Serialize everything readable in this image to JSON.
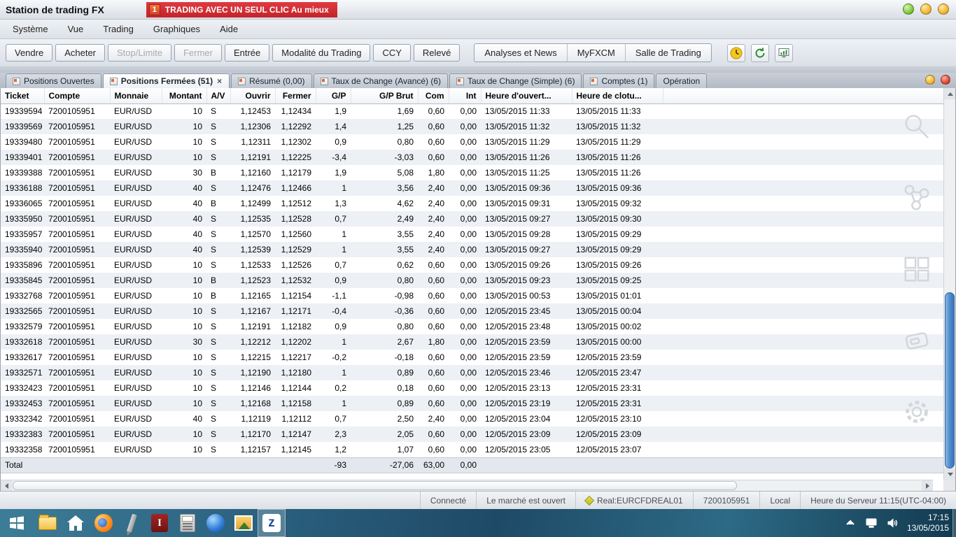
{
  "window": {
    "title": "Station de trading FX",
    "banner": {
      "badge": "1",
      "text": "TRADING AVEC UN SEUL CLIC Au mieux"
    },
    "controls": [
      "minimize",
      "restore",
      "close"
    ]
  },
  "menu": {
    "items": [
      "Système",
      "Vue",
      "Trading",
      "Graphiques",
      "Aide"
    ]
  },
  "toolbar": {
    "buttons": [
      {
        "label": "Vendre",
        "enabled": true
      },
      {
        "label": "Acheter",
        "enabled": true
      },
      {
        "label": "Stop/Limite",
        "enabled": false
      },
      {
        "label": "Fermer",
        "enabled": false
      },
      {
        "label": "Entrée",
        "enabled": true
      },
      {
        "label": "Modalité du Trading",
        "enabled": true
      },
      {
        "label": "CCY",
        "enabled": true
      },
      {
        "label": "Relevé",
        "enabled": true
      }
    ],
    "links": [
      "Analyses et News",
      "MyFXCM",
      "Salle de Trading"
    ],
    "icon_buttons": [
      "clock-icon",
      "refresh-icon",
      "market-monitor-icon"
    ]
  },
  "tabs": [
    {
      "label": "Positions Ouvertes",
      "active": false
    },
    {
      "label": "Positions Fermées (51)",
      "active": true,
      "close": "×"
    },
    {
      "label": "Résumé (0,00)",
      "active": false
    },
    {
      "label": "Taux de Change (Avancé) (6)",
      "active": false
    },
    {
      "label": "Taux de Change (Simple) (6)",
      "active": false
    },
    {
      "label": "Comptes (1)",
      "active": false
    },
    {
      "label": "Opération",
      "active": false
    }
  ],
  "table": {
    "columns": [
      "Ticket",
      "Compte",
      "Monnaie",
      "Montant",
      "A/V",
      "Ouvrir",
      "Fermer",
      "G/P",
      "G/P Brut",
      "Com",
      "Int",
      "Heure d'ouvert...",
      "Heure de clotu..."
    ],
    "column_keys": [
      "ticket",
      "compte",
      "monnaie",
      "montant",
      "av",
      "ouvrir",
      "fermer",
      "gp",
      "gp_brut",
      "com",
      "int",
      "heure_ouverture",
      "heure_cloture"
    ],
    "rows": [
      [
        "19339594",
        "7200105951",
        "EUR/USD",
        "10",
        "S",
        "1,12453",
        "1,12434",
        "1,9",
        "1,69",
        "0,60",
        "0,00",
        "13/05/2015 11:33",
        "13/05/2015 11:33"
      ],
      [
        "19339569",
        "7200105951",
        "EUR/USD",
        "10",
        "S",
        "1,12306",
        "1,12292",
        "1,4",
        "1,25",
        "0,60",
        "0,00",
        "13/05/2015 11:32",
        "13/05/2015 11:32"
      ],
      [
        "19339480",
        "7200105951",
        "EUR/USD",
        "10",
        "S",
        "1,12311",
        "1,12302",
        "0,9",
        "0,80",
        "0,60",
        "0,00",
        "13/05/2015 11:29",
        "13/05/2015 11:29"
      ],
      [
        "19339401",
        "7200105951",
        "EUR/USD",
        "10",
        "S",
        "1,12191",
        "1,12225",
        "-3,4",
        "-3,03",
        "0,60",
        "0,00",
        "13/05/2015 11:26",
        "13/05/2015 11:26"
      ],
      [
        "19339388",
        "7200105951",
        "EUR/USD",
        "30",
        "B",
        "1,12160",
        "1,12179",
        "1,9",
        "5,08",
        "1,80",
        "0,00",
        "13/05/2015 11:25",
        "13/05/2015 11:26"
      ],
      [
        "19336188",
        "7200105951",
        "EUR/USD",
        "40",
        "S",
        "1,12476",
        "1,12466",
        "1",
        "3,56",
        "2,40",
        "0,00",
        "13/05/2015 09:36",
        "13/05/2015 09:36"
      ],
      [
        "19336065",
        "7200105951",
        "EUR/USD",
        "40",
        "B",
        "1,12499",
        "1,12512",
        "1,3",
        "4,62",
        "2,40",
        "0,00",
        "13/05/2015 09:31",
        "13/05/2015 09:32"
      ],
      [
        "19335950",
        "7200105951",
        "EUR/USD",
        "40",
        "S",
        "1,12535",
        "1,12528",
        "0,7",
        "2,49",
        "2,40",
        "0,00",
        "13/05/2015 09:27",
        "13/05/2015 09:30"
      ],
      [
        "19335957",
        "7200105951",
        "EUR/USD",
        "40",
        "S",
        "1,12570",
        "1,12560",
        "1",
        "3,55",
        "2,40",
        "0,00",
        "13/05/2015 09:28",
        "13/05/2015 09:29"
      ],
      [
        "19335940",
        "7200105951",
        "EUR/USD",
        "40",
        "S",
        "1,12539",
        "1,12529",
        "1",
        "3,55",
        "2,40",
        "0,00",
        "13/05/2015 09:27",
        "13/05/2015 09:29"
      ],
      [
        "19335896",
        "7200105951",
        "EUR/USD",
        "10",
        "S",
        "1,12533",
        "1,12526",
        "0,7",
        "0,62",
        "0,60",
        "0,00",
        "13/05/2015 09:26",
        "13/05/2015 09:26"
      ],
      [
        "19335845",
        "7200105951",
        "EUR/USD",
        "10",
        "B",
        "1,12523",
        "1,12532",
        "0,9",
        "0,80",
        "0,60",
        "0,00",
        "13/05/2015 09:23",
        "13/05/2015 09:25"
      ],
      [
        "19332768",
        "7200105951",
        "EUR/USD",
        "10",
        "B",
        "1,12165",
        "1,12154",
        "-1,1",
        "-0,98",
        "0,60",
        "0,00",
        "13/05/2015 00:53",
        "13/05/2015 01:01"
      ],
      [
        "19332565",
        "7200105951",
        "EUR/USD",
        "10",
        "S",
        "1,12167",
        "1,12171",
        "-0,4",
        "-0,36",
        "0,60",
        "0,00",
        "12/05/2015 23:45",
        "13/05/2015 00:04"
      ],
      [
        "19332579",
        "7200105951",
        "EUR/USD",
        "10",
        "S",
        "1,12191",
        "1,12182",
        "0,9",
        "0,80",
        "0,60",
        "0,00",
        "12/05/2015 23:48",
        "13/05/2015 00:02"
      ],
      [
        "19332618",
        "7200105951",
        "EUR/USD",
        "30",
        "S",
        "1,12212",
        "1,12202",
        "1",
        "2,67",
        "1,80",
        "0,00",
        "12/05/2015 23:59",
        "13/05/2015 00:00"
      ],
      [
        "19332617",
        "7200105951",
        "EUR/USD",
        "10",
        "S",
        "1,12215",
        "1,12217",
        "-0,2",
        "-0,18",
        "0,60",
        "0,00",
        "12/05/2015 23:59",
        "12/05/2015 23:59"
      ],
      [
        "19332571",
        "7200105951",
        "EUR/USD",
        "10",
        "S",
        "1,12190",
        "1,12180",
        "1",
        "0,89",
        "0,60",
        "0,00",
        "12/05/2015 23:46",
        "12/05/2015 23:47"
      ],
      [
        "19332423",
        "7200105951",
        "EUR/USD",
        "10",
        "S",
        "1,12146",
        "1,12144",
        "0,2",
        "0,18",
        "0,60",
        "0,00",
        "12/05/2015 23:13",
        "12/05/2015 23:31"
      ],
      [
        "19332453",
        "7200105951",
        "EUR/USD",
        "10",
        "S",
        "1,12168",
        "1,12158",
        "1",
        "0,89",
        "0,60",
        "0,00",
        "12/05/2015 23:19",
        "12/05/2015 23:31"
      ],
      [
        "19332342",
        "7200105951",
        "EUR/USD",
        "40",
        "S",
        "1,12119",
        "1,12112",
        "0,7",
        "2,50",
        "2,40",
        "0,00",
        "12/05/2015 23:04",
        "12/05/2015 23:10"
      ],
      [
        "19332383",
        "7200105951",
        "EUR/USD",
        "10",
        "S",
        "1,12170",
        "1,12147",
        "2,3",
        "2,05",
        "0,60",
        "0,00",
        "12/05/2015 23:09",
        "12/05/2015 23:09"
      ],
      [
        "19332358",
        "7200105951",
        "EUR/USD",
        "10",
        "S",
        "1,12157",
        "1,12145",
        "1,2",
        "1,07",
        "0,60",
        "0,00",
        "12/05/2015 23:05",
        "12/05/2015 23:07"
      ]
    ],
    "total": {
      "label": "Total",
      "gp": "-93",
      "gp_brut": "-27,06",
      "com": "63,00",
      "int": "0,00"
    }
  },
  "watermark_icons": [
    "magnifier-icon",
    "share-icon",
    "window-grid-icon",
    "card-icon",
    "gear-icon"
  ],
  "statusbar": {
    "connection": "Connecté",
    "market": "Le marché est ouvert",
    "account_type": "Real:EURCFDREAL01",
    "account_id": "7200105951",
    "mode": "Local",
    "server_time": "Heure du Serveur 11:15(UTC-04:00)"
  },
  "taskbar": {
    "apps": [
      "start",
      "file-explorer",
      "home",
      "firefox",
      "pen-tool",
      "trading-alert-app",
      "calculator",
      "browser",
      "photos",
      "trading-station"
    ],
    "active_app": "trading-station",
    "trading_station_glyph": "z",
    "clock_time": "17:15",
    "clock_date": "13/05/2015"
  },
  "colors": {
    "banner_red": "#c3242b",
    "scroll_thumb_blue": "#4d88c9",
    "row_alt": "#edf1f6"
  }
}
